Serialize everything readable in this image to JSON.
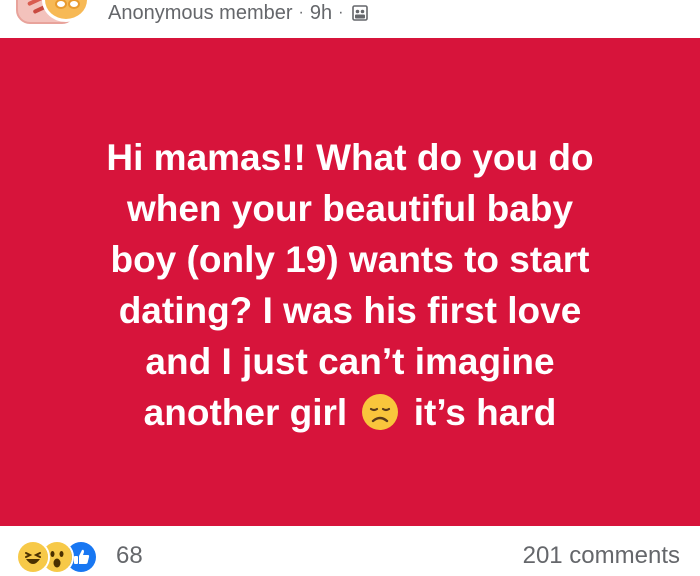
{
  "header": {
    "author": "Anonymous member",
    "separator": "·",
    "time": "9h",
    "separator2": "·",
    "privacy_icon": "group-privacy-icon"
  },
  "post": {
    "line1": "Hi mamas!! What do you do",
    "line2": "when your beautiful baby",
    "line3": "boy (only 19) wants to start",
    "line4": "dating? I was his first love",
    "line5": "and I just can’t imagine",
    "line6_a": "another girl",
    "line6_emoji": "disappointed-face-emoji",
    "line6_b": "it’s hard",
    "background_color": "#d7143b",
    "text_color": "#ffffff"
  },
  "footer": {
    "reaction_icons": [
      "haha-reaction-icon",
      "wow-reaction-icon",
      "like-reaction-icon"
    ],
    "reaction_count": "68",
    "comments": "201 comments"
  }
}
